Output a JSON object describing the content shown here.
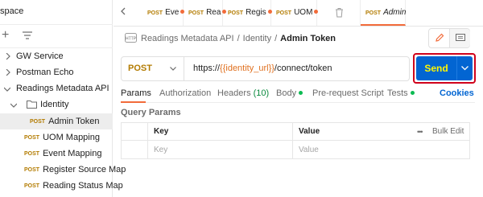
{
  "sidebar": {
    "workspace_title": "space",
    "items": [
      {
        "label": "GW Service"
      },
      {
        "label": "Postman Echo"
      },
      {
        "label": "Readings Metadata API"
      },
      {
        "label": "Identity"
      },
      {
        "method": "POST",
        "label": "Admin Token"
      },
      {
        "method": "POST",
        "label": "UOM Mapping"
      },
      {
        "method": "POST",
        "label": "Event Mapping"
      },
      {
        "method": "POST",
        "label": "Register Source Map"
      },
      {
        "method": "POST",
        "label": "Reading Status Map"
      }
    ]
  },
  "tabs": [
    {
      "method": "POST",
      "label": "Eve"
    },
    {
      "method": "POST",
      "label": "Rea"
    },
    {
      "method": "POST",
      "label": "Regis"
    },
    {
      "method": "POST",
      "label": "UOM"
    },
    {
      "method": "POST",
      "label": "Admin"
    }
  ],
  "breadcrumb": {
    "badge": "HTTP",
    "parts": [
      "Readings Metadata API",
      "Identity"
    ],
    "current": "Admin Token",
    "separator": "/"
  },
  "request": {
    "method": "POST",
    "url_prefix": "https://",
    "url_variable": "{{identity_url}}",
    "url_suffix": "/connect/token",
    "send_label": "Send"
  },
  "request_tabs": {
    "params": "Params",
    "authorization": "Authorization",
    "headers": "Headers",
    "headers_count": "(10)",
    "body": "Body",
    "pre_request": "Pre-request Script",
    "tests": "Tests",
    "cookies": "Cookies"
  },
  "query_params": {
    "title": "Query Params",
    "key_header": "Key",
    "value_header": "Value",
    "bulk_edit": "Bulk Edit",
    "more": "•••",
    "key_placeholder": "Key",
    "value_placeholder": "Value"
  },
  "colors": {
    "method": "#b37b00",
    "accent": "#f26b3a",
    "send_bg": "#0265d2",
    "send_text": "#fff600",
    "highlight": "#d0021b",
    "variable": "#e0701f",
    "dot_green": "#0cbb52"
  },
  "icons": [
    "plus-icon",
    "filter-icon",
    "chevron-right-icon",
    "chevron-down-icon",
    "folder-icon",
    "tab-scroll-left-icon",
    "dot-icon",
    "trash-icon",
    "http-icon",
    "edit-icon",
    "comment-icon",
    "caret-down-icon",
    "more-icon"
  ]
}
